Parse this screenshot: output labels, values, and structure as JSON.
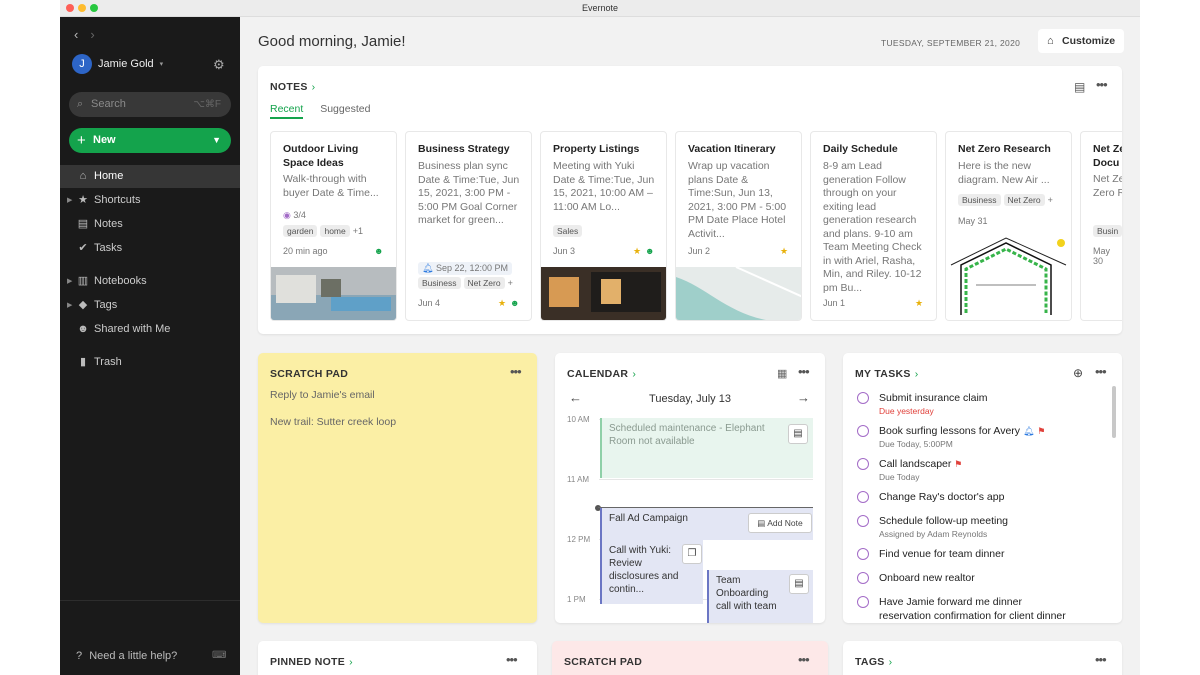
{
  "window": {
    "title": "Evernote"
  },
  "sidebar": {
    "user_initial": "J",
    "user_name": "Jamie Gold",
    "search_placeholder": "Search",
    "search_shortcut": "⌥⌘F",
    "new_label": "New",
    "items": [
      {
        "label": "Home",
        "icon": "home-icon"
      },
      {
        "label": "Shortcuts",
        "icon": "star-icon"
      },
      {
        "label": "Notes",
        "icon": "note-icon"
      },
      {
        "label": "Tasks",
        "icon": "check-circle-icon"
      },
      {
        "label": "Notebooks",
        "icon": "notebook-icon"
      },
      {
        "label": "Tags",
        "icon": "tag-icon"
      },
      {
        "label": "Shared with Me",
        "icon": "people-icon"
      },
      {
        "label": "Trash",
        "icon": "trash-icon"
      }
    ],
    "help_label": "Need a little help?"
  },
  "header": {
    "greeting": "Good morning, Jamie!",
    "date": "TUESDAY, SEPTEMBER 21, 2020",
    "customize_label": "Customize"
  },
  "notes": {
    "title": "NOTES",
    "tabs": [
      "Recent",
      "Suggested"
    ],
    "cards": [
      {
        "title": "Outdoor Living Space Ideas",
        "snippet": "Walk-through with buyer Date & Time...",
        "progress": "3/4",
        "tags": [
          "garden",
          "home",
          "+1"
        ],
        "time": "20 min ago"
      },
      {
        "title": "Business Strategy",
        "snippet": "Business plan sync Date & Time:Tue, Jun 15, 2021, 3:00 PM - 5:00 PM Goal Corner market for green...",
        "reminder": "Sep 22, 12:00 PM",
        "tags": [
          "Business",
          "Net Zero",
          "+"
        ],
        "time": "Jun 4"
      },
      {
        "title": "Property Listings",
        "snippet": "Meeting with Yuki Date & Time:Tue, Jun 15, 2021, 10:00 AM – 11:00 AM Lo...",
        "tags": [
          "Sales"
        ],
        "time": "Jun 3"
      },
      {
        "title": "Vacation Itinerary",
        "snippet": "Wrap up vacation plans Date & Time:Sun, Jun 13, 2021, 3:00 PM - 5:00 PM Date Place Hotel Activit...",
        "time": "Jun 2"
      },
      {
        "title": "Daily Schedule",
        "snippet": "8-9 am Lead generation Follow through on your exiting lead generation research and plans. 9-10 am Team Meeting Check in with Ariel, Rasha, Min, and Riley. 10-12 pm Bu...",
        "time": "Jun  1"
      },
      {
        "title": "Net Zero Research",
        "snippet": "Here is the new diagram. New Air ...",
        "tags": [
          "Business",
          "Net Zero",
          "+"
        ],
        "time": "May 31"
      },
      {
        "title": "Net Ze Docu",
        "snippet": "Net Ze Docu Zero R",
        "tags": [
          "Busin"
        ],
        "time": "May 30"
      }
    ]
  },
  "scratch": {
    "title": "SCRATCH PAD",
    "lines": [
      "Reply to Jamie's email",
      "New trail: Sutter creek loop"
    ]
  },
  "calendar": {
    "title": "CALENDAR",
    "day": "Tuesday, July 13",
    "times": [
      "10 AM",
      "11 AM",
      "12 PM",
      "1 PM"
    ],
    "events": [
      "Scheduled maintenance - Elephant Room not available",
      "Fall Ad Campaign",
      "Call with Yuki: Review disclosures and contin...",
      "Team Onboarding call with team"
    ],
    "add_note": "Add Note"
  },
  "tasks": {
    "title": "MY TASKS",
    "items": [
      {
        "title": "Submit insurance claim",
        "sub": "Due yesterday"
      },
      {
        "title": "Book surfing lessons for Avery",
        "sub": "Due Today, 5:00PM"
      },
      {
        "title": "Call landscaper",
        "sub": "Due Today"
      },
      {
        "title": "Change Ray's doctor's app",
        "sub": ""
      },
      {
        "title": "Schedule follow-up meeting",
        "sub": "Assigned by Adam Reynolds"
      },
      {
        "title": "Find venue for team dinner",
        "sub": ""
      },
      {
        "title": "Onboard new realtor",
        "sub": ""
      },
      {
        "title": "Have Jamie forward me dinner",
        "sub": "reservation confirmation for client dinner"
      }
    ]
  },
  "bottom": {
    "pinned": "PINNED NOTE",
    "scratch2": "SCRATCH PAD",
    "tags": "TAGS"
  },
  "colors": {
    "accent": "#14a34c",
    "sidebar": "#1a1a1a",
    "scratch": "#fbefa5",
    "scratch2": "#fde8e8",
    "task_circle": "#a36cc7",
    "overdue": "#e0403a"
  }
}
